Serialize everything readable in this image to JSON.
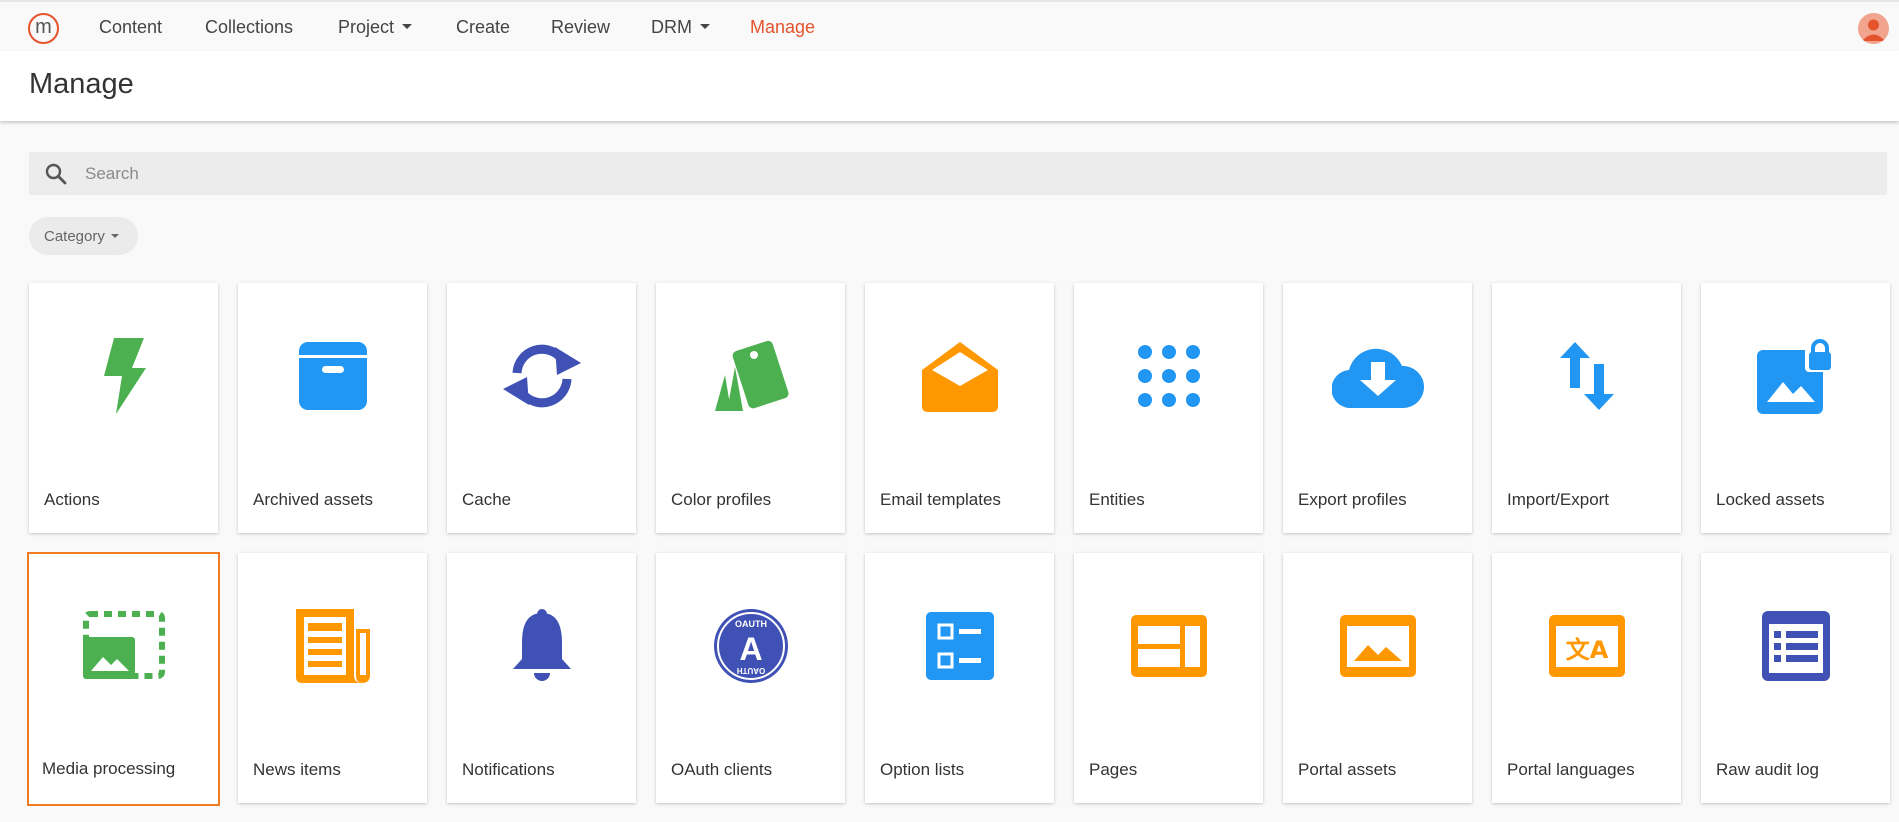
{
  "nav": {
    "logo_letter": "m",
    "items": [
      {
        "label": "Content",
        "has_caret": false
      },
      {
        "label": "Collections",
        "has_caret": false
      },
      {
        "label": "Project",
        "has_caret": true
      },
      {
        "label": "Create",
        "has_caret": false
      },
      {
        "label": "Review",
        "has_caret": false
      },
      {
        "label": "DRM",
        "has_caret": true
      },
      {
        "label": "Manage",
        "has_caret": false,
        "active": true
      }
    ],
    "active_color": "#e5532d"
  },
  "page": {
    "title": "Manage"
  },
  "search": {
    "placeholder": "Search",
    "value": ""
  },
  "filter": {
    "label": "Category"
  },
  "tiles": [
    {
      "label": "Actions",
      "icon": "lightning-icon",
      "color": "#4caf50"
    },
    {
      "label": "Archived assets",
      "icon": "archive-box-icon",
      "color": "#2196f3"
    },
    {
      "label": "Cache",
      "icon": "sync-icon",
      "color": "#3f51b5"
    },
    {
      "label": "Color profiles",
      "icon": "color-cards-icon",
      "color": "#4caf50"
    },
    {
      "label": "Email templates",
      "icon": "envelope-open-icon",
      "color": "#ff9800"
    },
    {
      "label": "Entities",
      "icon": "apps-grid-icon",
      "color": "#2196f3"
    },
    {
      "label": "Export profiles",
      "icon": "cloud-download-icon",
      "color": "#2196f3"
    },
    {
      "label": "Import/Export",
      "icon": "swap-vertical-icon",
      "color": "#2196f3"
    },
    {
      "label": "Locked assets",
      "icon": "locked-image-icon",
      "color": "#2196f3"
    },
    {
      "label": "Media processing",
      "icon": "image-processing-icon",
      "color": "#4caf50",
      "selected": true
    },
    {
      "label": "News items",
      "icon": "newspaper-icon",
      "color": "#ff9800"
    },
    {
      "label": "Notifications",
      "icon": "bell-icon",
      "color": "#3f51b5"
    },
    {
      "label": "OAuth clients",
      "icon": "oauth-badge-icon",
      "color": "#3f51b5",
      "badge_text": "OAUTH",
      "badge_letter": "A"
    },
    {
      "label": "Option lists",
      "icon": "checklist-icon",
      "color": "#2196f3"
    },
    {
      "label": "Pages",
      "icon": "web-layout-icon",
      "color": "#ff9800"
    },
    {
      "label": "Portal assets",
      "icon": "portal-image-icon",
      "color": "#ff9800"
    },
    {
      "label": "Portal languages",
      "icon": "translate-icon",
      "color": "#ff9800",
      "glyph": "文A"
    },
    {
      "label": "Raw audit log",
      "icon": "list-document-icon",
      "color": "#3f51b5"
    }
  ],
  "selection_color": "#f07b22"
}
